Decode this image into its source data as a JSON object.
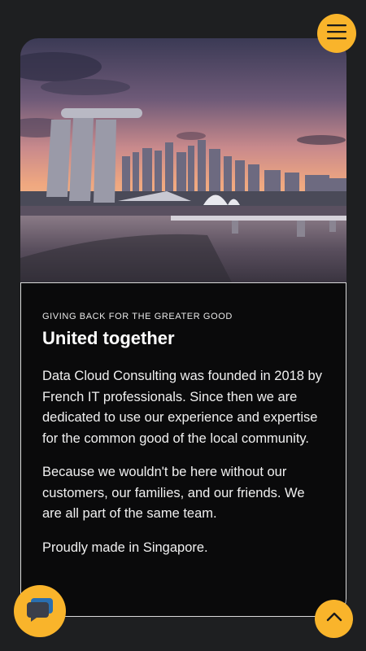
{
  "hero": {
    "image_description_icon": "singapore-skyline-image"
  },
  "section": {
    "eyebrow": "GIVING BACK FOR THE GREATER GOOD",
    "title": "United together",
    "paragraphs": [
      "Data Cloud Consulting was founded in 2018 by French IT professionals. Since then we are dedicated to use our experience and expertise for the common good of the local community.",
      "Because we wouldn't be here without our customers, our families, and our friends. We are all part of the same team.",
      "Proudly made in Singapore."
    ]
  },
  "buttons": {
    "menu_icon": "hamburger-menu-icon",
    "chat_icon": "chat-bubbles-icon",
    "scroll_top_icon": "chevron-up-icon"
  },
  "colors": {
    "accent": "#f9b42b",
    "background": "#1e1f21",
    "card": "#0a0a0b"
  }
}
